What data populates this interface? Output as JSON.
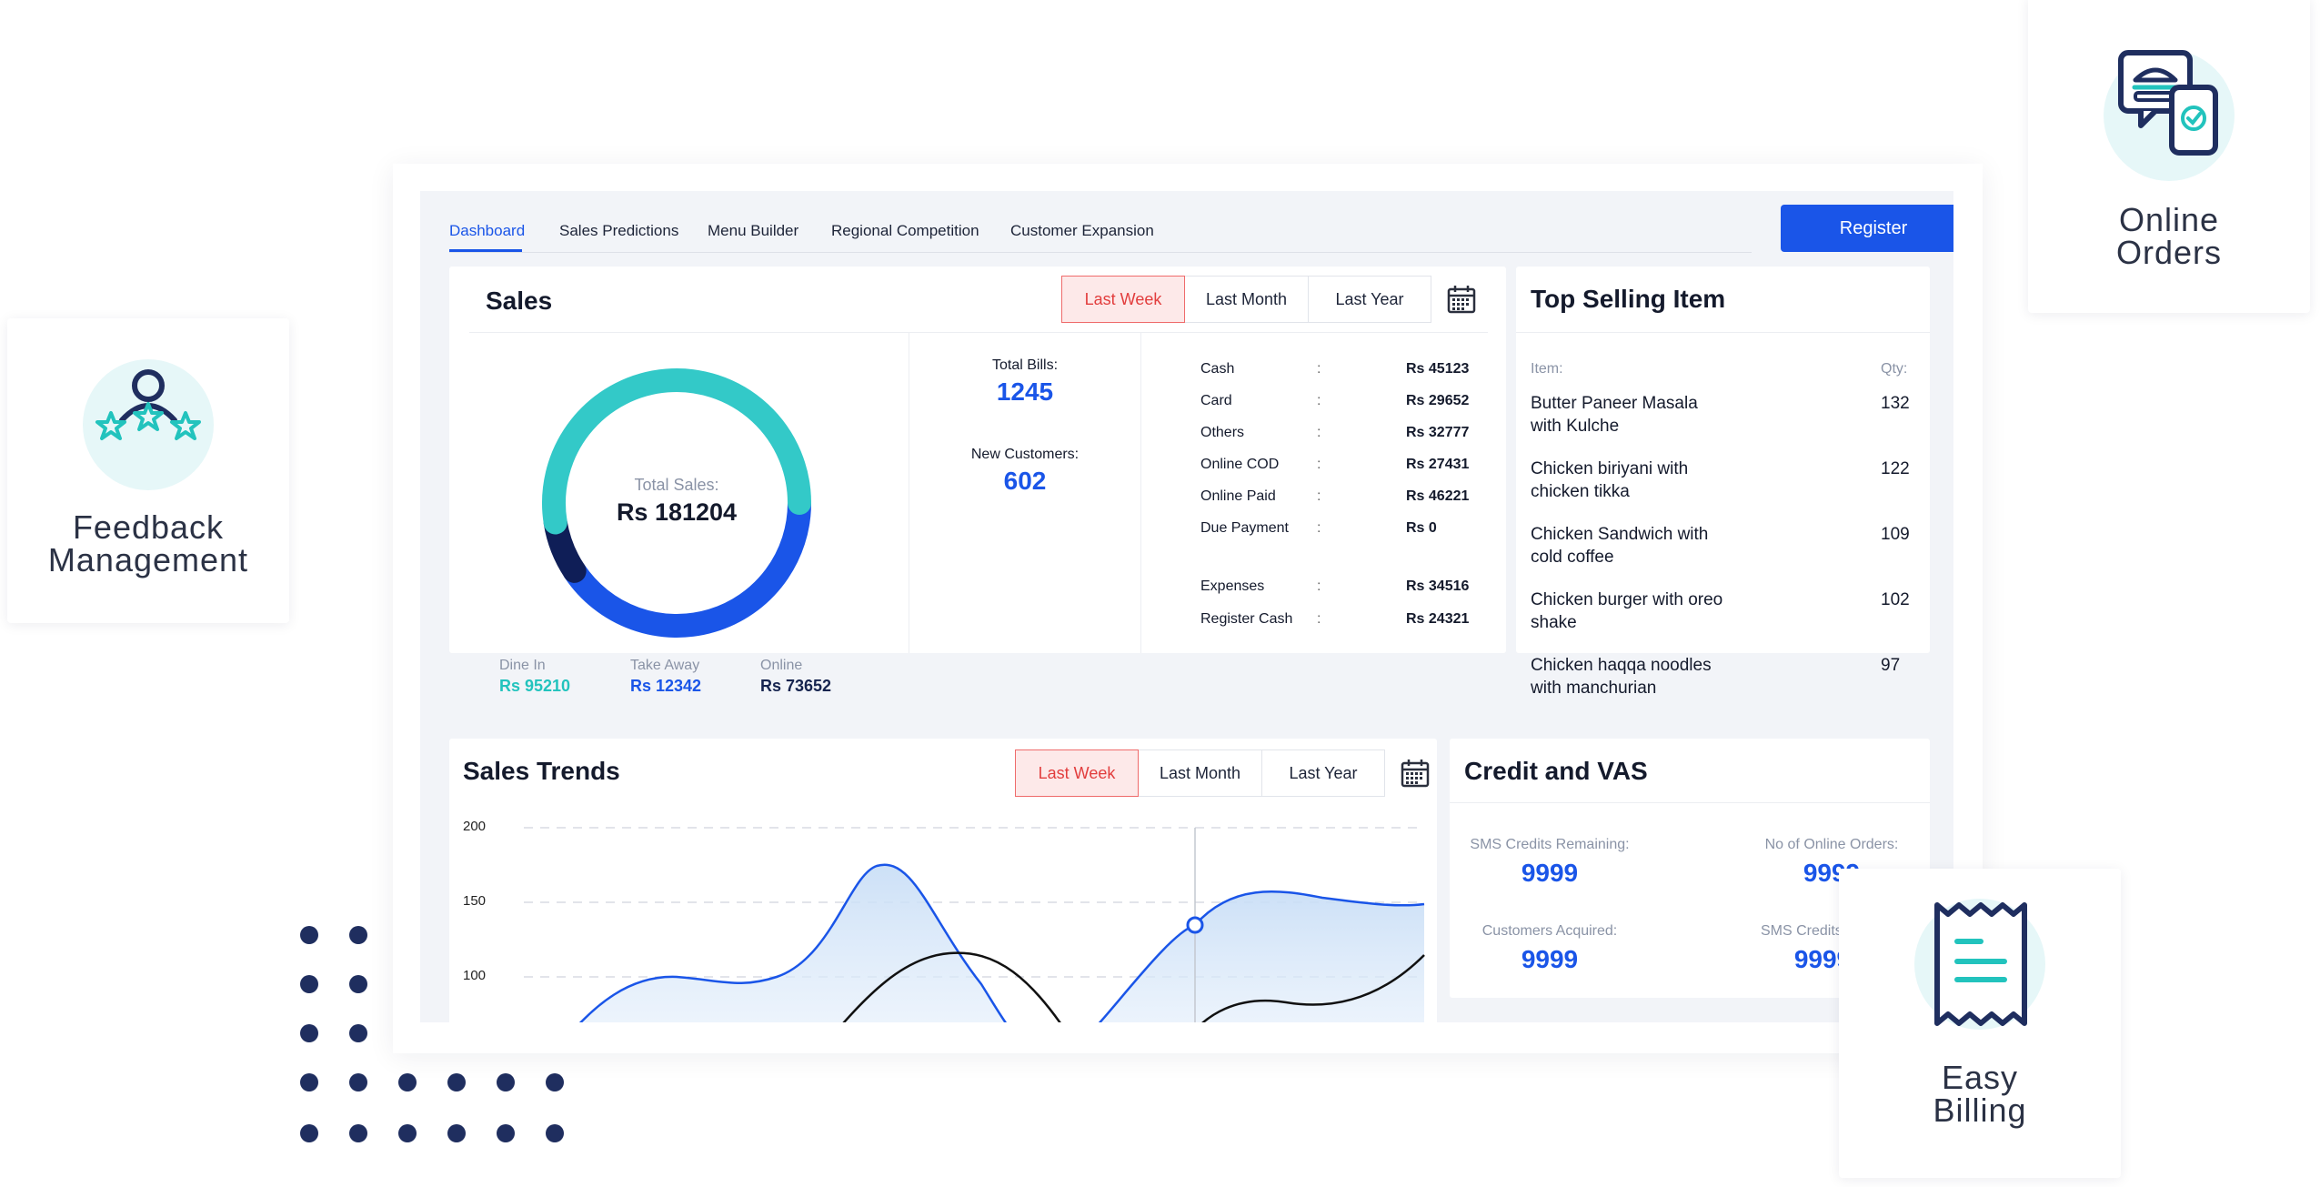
{
  "features": {
    "feedback": {
      "line1": "Feedback",
      "line2": "Management"
    },
    "online_orders": {
      "line1": "Online",
      "line2": "Orders"
    },
    "easy_billing": {
      "line1": "Easy",
      "line2": "Billing"
    }
  },
  "nav": {
    "tabs": [
      {
        "label": "Dashboard",
        "active": true
      },
      {
        "label": "Sales Predictions"
      },
      {
        "label": "Menu Builder"
      },
      {
        "label": "Regional Competition"
      },
      {
        "label": "Customer Expansion"
      }
    ],
    "register_label": "Register"
  },
  "periods": [
    "Last Week",
    "Last Month",
    "Last Year"
  ],
  "sales": {
    "title": "Sales",
    "center_label": "Total Sales:",
    "center_value": "Rs 181204",
    "donut": {
      "dine_in": 95210,
      "take_away": 12342,
      "online": 73652,
      "colors": {
        "dine_in": "#33c9c8",
        "take_away": "#0f1e57",
        "online": "#1a55e8"
      }
    },
    "breakdown": [
      {
        "label": "Dine In",
        "value": "Rs 95210"
      },
      {
        "label": "Take Away",
        "value": "Rs 12342"
      },
      {
        "label": "Online",
        "value": "Rs 73652"
      }
    ],
    "total_bills_label": "Total Bills:",
    "total_bills": "1245",
    "new_customers_label": "New Customers:",
    "new_customers": "602",
    "payments": [
      {
        "label": "Cash",
        "value": "Rs 45123"
      },
      {
        "label": "Card",
        "value": "Rs 29652"
      },
      {
        "label": "Others",
        "value": "Rs 32777"
      },
      {
        "label": "Online COD",
        "value": "Rs 27431"
      },
      {
        "label": "Online Paid",
        "value": "Rs 46221"
      },
      {
        "label": "Due Payment",
        "value": "Rs 0"
      }
    ],
    "expenses": [
      {
        "label": "Expenses",
        "value": "Rs 34516"
      },
      {
        "label": "Register Cash",
        "value": "Rs 24321"
      }
    ],
    "separator": ":"
  },
  "top_selling": {
    "title": "Top Selling Item",
    "col_item": "Item:",
    "col_qty": "Qty:",
    "items": [
      {
        "name": "Butter Paneer Masala with Kulche",
        "qty": "132"
      },
      {
        "name": "Chicken biriyani with chicken tikka",
        "qty": "122"
      },
      {
        "name": "Chicken Sandwich with cold coffee",
        "qty": "109"
      },
      {
        "name": "Chicken burger with oreo shake",
        "qty": "102"
      },
      {
        "name": "Chicken haqqa noodles with manchurian",
        "qty": "97"
      }
    ]
  },
  "trends": {
    "title": "Sales Trends",
    "y_ticks": [
      "200",
      "150",
      "100"
    ],
    "accent": "#1a55e8"
  },
  "credit": {
    "title": "Credit and VAS",
    "sms_remaining_label": "SMS Credits Remaining:",
    "sms_remaining": "9999",
    "online_orders_label": "No of Online Orders:",
    "online_orders": "9999",
    "customers_acquired_label": "Customers Acquired:",
    "customers_acquired": "9999",
    "sms_used_label": "SMS Credits Used:",
    "sms_used": "9999"
  }
}
